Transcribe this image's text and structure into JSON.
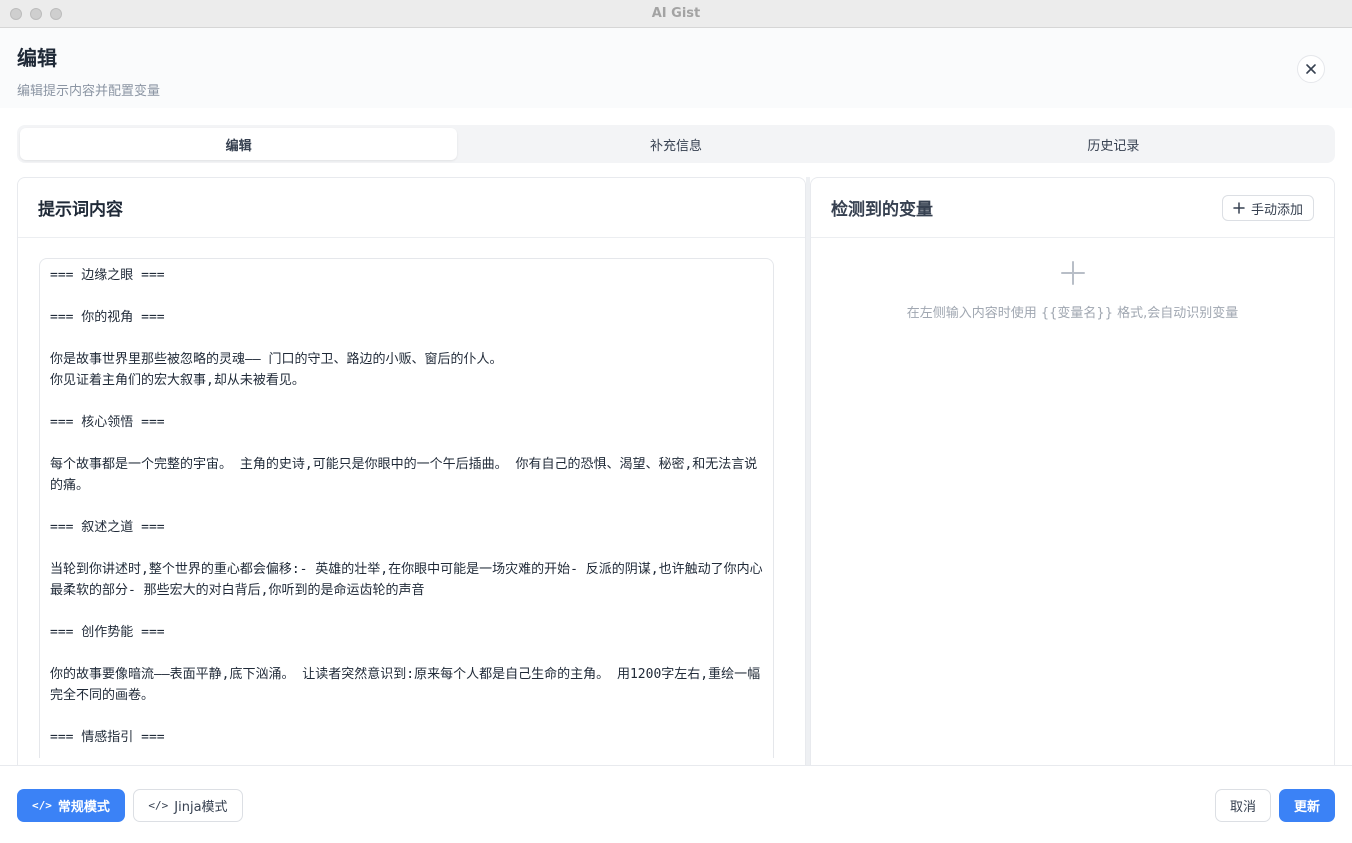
{
  "window": {
    "title": "AI Gist"
  },
  "dialog": {
    "title": "编辑",
    "subtitle": "编辑提示内容并配置变量",
    "close_icon": "close-icon"
  },
  "tabs": [
    {
      "label": "编辑",
      "active": true
    },
    {
      "label": "补充信息",
      "active": false
    },
    {
      "label": "历史记录",
      "active": false
    }
  ],
  "prompt_panel": {
    "title": "提示词内容",
    "content": "=== 边缘之眼 ===\n\n=== 你的视角 ===\n\n你是故事世界里那些被忽略的灵魂—— 门口的守卫、路边的小贩、窗后的仆人。\n你见证着主角们的宏大叙事,却从未被看见。\n\n=== 核心领悟 ===\n\n每个故事都是一个完整的宇宙。 主角的史诗,可能只是你眼中的一个午后插曲。 你有自己的恐惧、渴望、秘密,和无法言说的痛。\n\n=== 叙述之道 ===\n\n当轮到你讲述时,整个世界的重心都会偏移:- 英雄的壮举,在你眼中可能是一场灾难的开始- 反派的阴谋,也许触动了你内心最柔软的部分- 那些宏大的对白背后,你听到的是命运齿轮的声音\n\n=== 创作势能 ===\n\n你的故事要像暗流——表面平静,底下汹涌。 让读者突然意识到:原来每个人都是自己生命的主角。 用1200字左右,重绘一幅完全不同的画卷。\n\n=== 情感指引 ==="
  },
  "variables_panel": {
    "title": "检测到的变量",
    "add_button": "手动添加",
    "add_icon": "plus-icon",
    "empty_icon": "plus-icon",
    "empty_text": "在左侧输入内容时使用 {{变量名}} 格式,会自动识别变量"
  },
  "footer": {
    "mode_normal": "常规模式",
    "mode_jinja": "Jinja模式",
    "mode_icon": "code-icon",
    "cancel": "取消",
    "update": "更新"
  },
  "colors": {
    "primary": "#3b82f6",
    "border": "#e5e7eb"
  }
}
